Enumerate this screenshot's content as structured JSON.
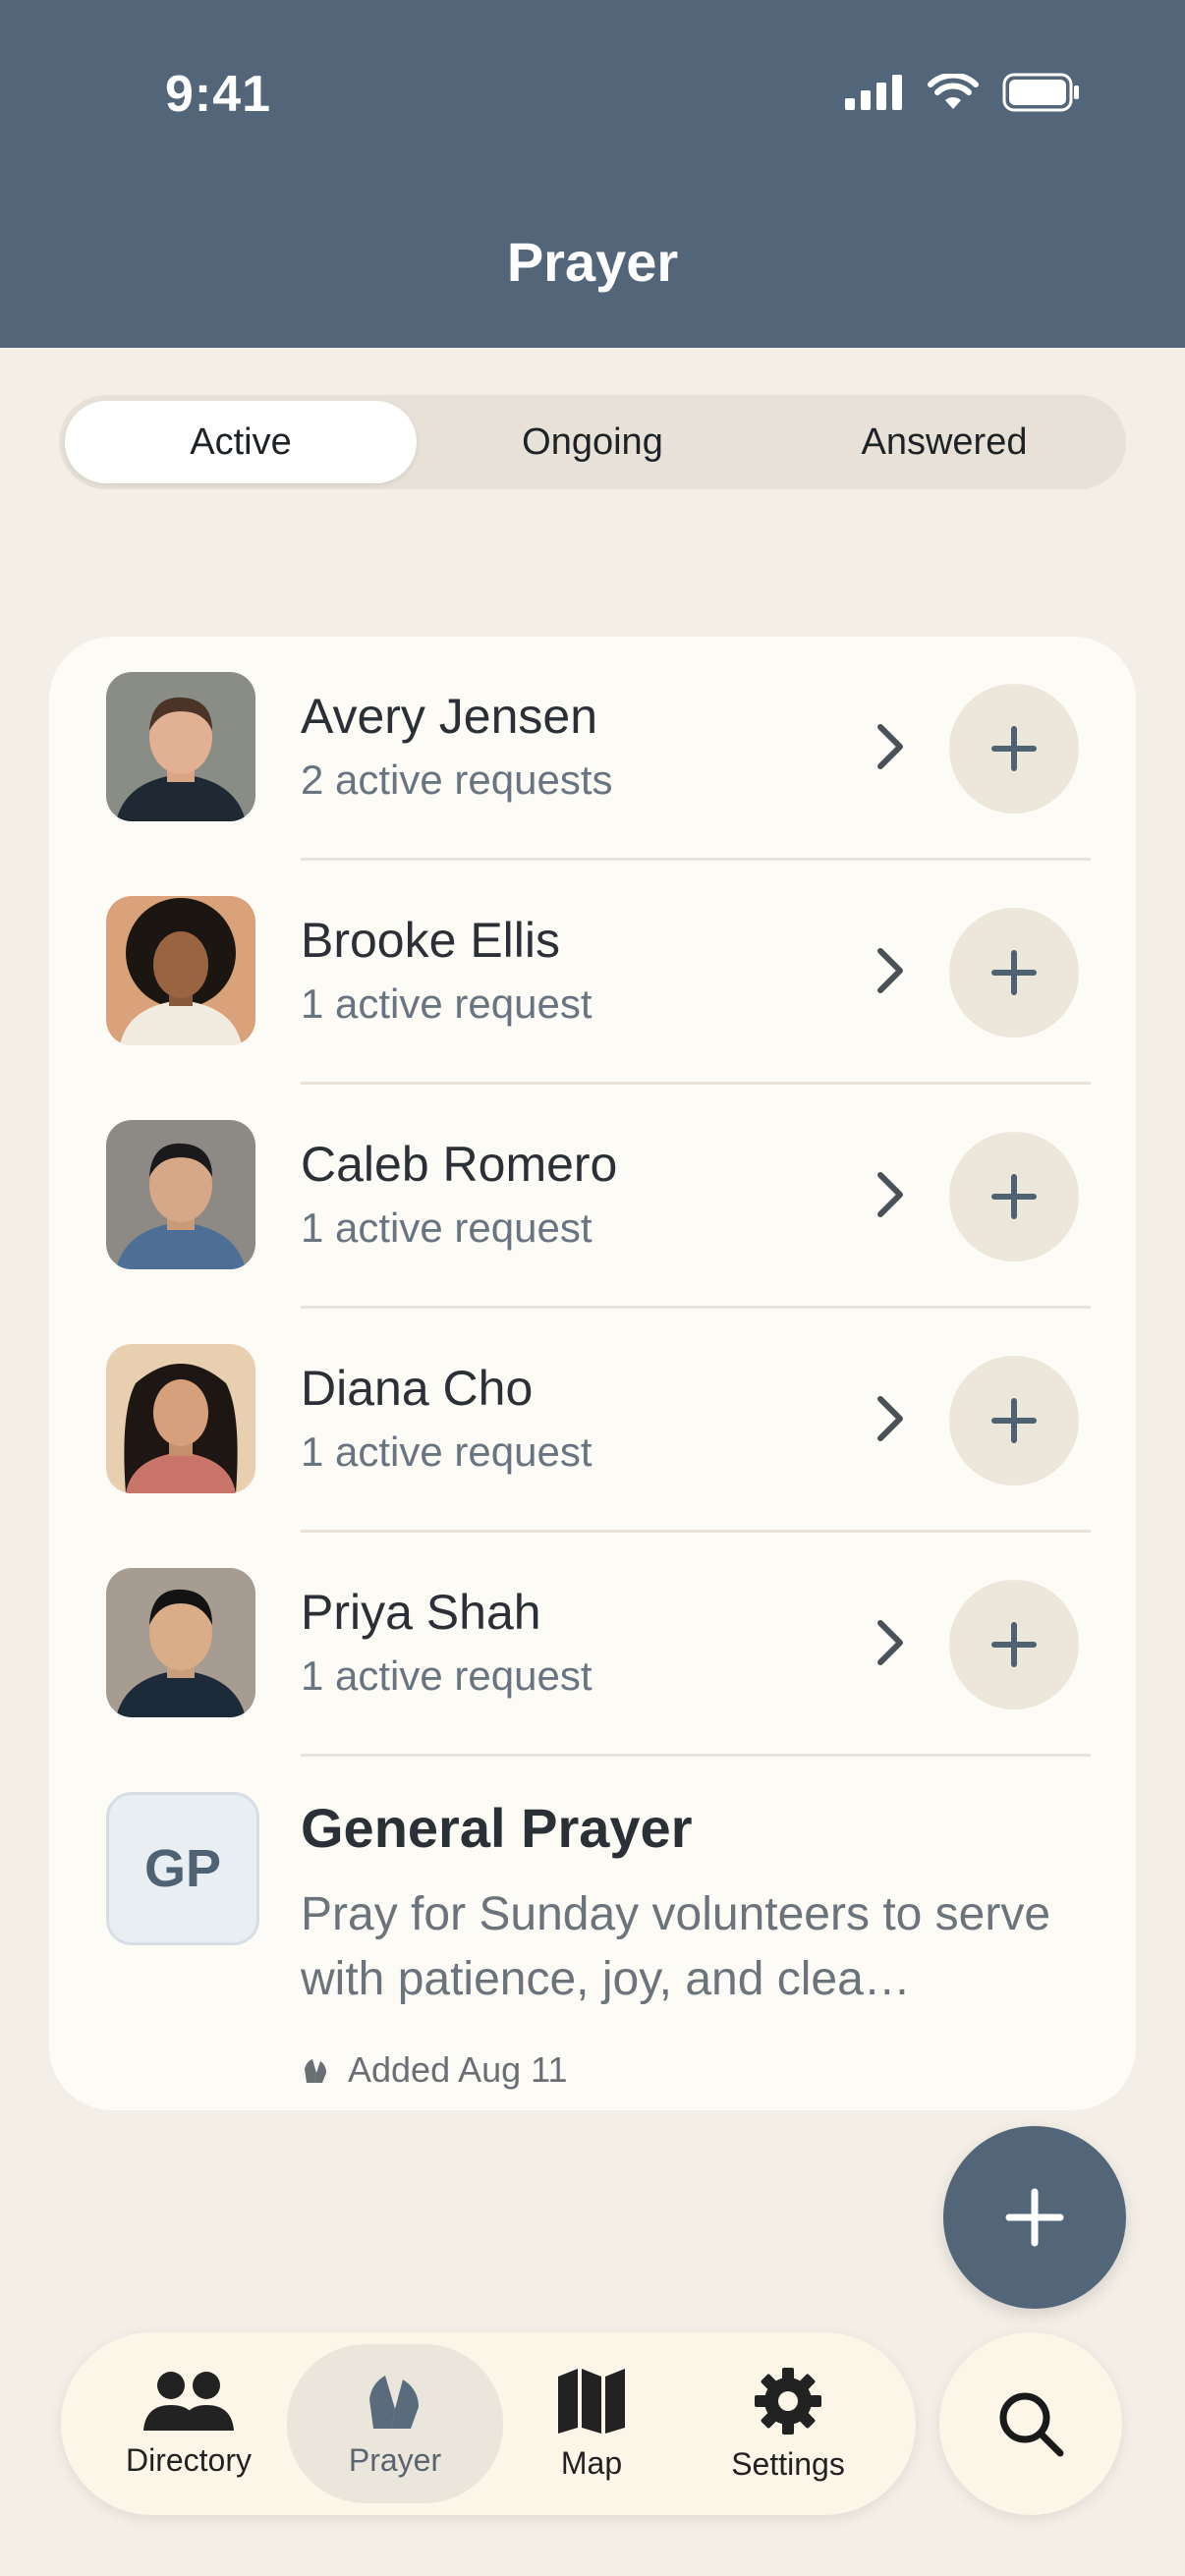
{
  "status_bar": {
    "time": "9:41"
  },
  "header": {
    "title": "Prayer"
  },
  "tabs": [
    "Active",
    "Ongoing",
    "Answered"
  ],
  "people": [
    {
      "name": "Avery Jensen",
      "sub": "2 active requests"
    },
    {
      "name": "Brooke Ellis",
      "sub": "1 active request"
    },
    {
      "name": "Caleb Romero",
      "sub": "1 active request"
    },
    {
      "name": "Diana Cho",
      "sub": "1 active request"
    },
    {
      "name": "Priya Shah",
      "sub": "1 active request"
    }
  ],
  "general": {
    "initials": "GP",
    "title": "General Prayer",
    "text": "Pray for Sunday volunteers to serve with patience, joy, and clea…",
    "meta": "Added Aug 11"
  },
  "nav": {
    "directory": "Directory",
    "prayer": "Prayer",
    "map": "Map",
    "settings": "Settings"
  },
  "colors": {
    "header": "#536679",
    "background": "#f3eee6",
    "card": "#fdfbf6"
  }
}
